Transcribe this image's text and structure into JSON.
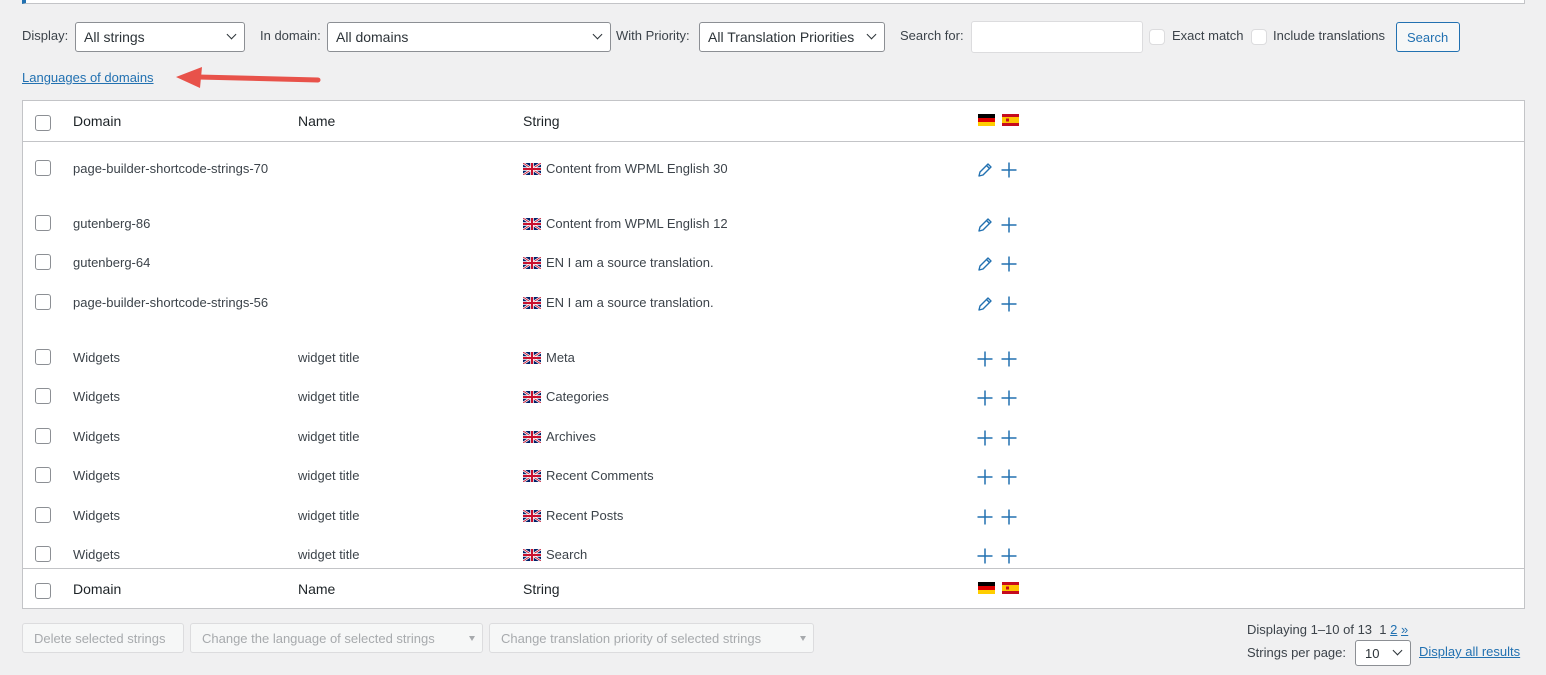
{
  "filters": {
    "display_label": "Display:",
    "display_value": "All strings",
    "domain_label": "In domain:",
    "domain_value": "All domains",
    "priority_label": "With Priority:",
    "priority_value": "All Translation Priorities",
    "search_label": "Search for:",
    "search_value": "",
    "exact_match_label": "Exact match",
    "include_translations_label": "Include translations",
    "search_button": "Search"
  },
  "languages_link": "Languages of domains",
  "columns": {
    "domain": "Domain",
    "name": "Name",
    "string": "String"
  },
  "language_flags": [
    "german-flag",
    "spanish-flag"
  ],
  "rows": [
    {
      "domain": "page-builder-shortcode-strings-70",
      "name": "",
      "string": "Content from WPML English 30",
      "actions": [
        "pencil-icon",
        "plus-icon"
      ]
    },
    {
      "domain": "gutenberg-86",
      "name": "",
      "string": "Content from WPML English 12",
      "actions": [
        "pencil-icon",
        "plus-icon"
      ]
    },
    {
      "domain": "gutenberg-64",
      "name": "",
      "string": "EN I am a source translation.",
      "actions": [
        "pencil-icon",
        "plus-icon"
      ]
    },
    {
      "domain": "page-builder-shortcode-strings-56",
      "name": "",
      "string": "EN I am a source translation.",
      "actions": [
        "pencil-icon",
        "plus-icon"
      ]
    },
    {
      "domain": "Widgets",
      "name": "widget title",
      "string": "Meta",
      "actions": [
        "plus-icon",
        "plus-icon"
      ]
    },
    {
      "domain": "Widgets",
      "name": "widget title",
      "string": "Categories",
      "actions": [
        "plus-icon",
        "plus-icon"
      ]
    },
    {
      "domain": "Widgets",
      "name": "widget title",
      "string": "Archives",
      "actions": [
        "plus-icon",
        "plus-icon"
      ]
    },
    {
      "domain": "Widgets",
      "name": "widget title",
      "string": "Recent Comments",
      "actions": [
        "plus-icon",
        "plus-icon"
      ]
    },
    {
      "domain": "Widgets",
      "name": "widget title",
      "string": "Recent Posts",
      "actions": [
        "plus-icon",
        "plus-icon"
      ]
    },
    {
      "domain": "Widgets",
      "name": "widget title",
      "string": "Search",
      "actions": [
        "plus-icon",
        "plus-icon"
      ]
    }
  ],
  "bulk": {
    "delete": "Delete selected strings",
    "change_language": "Change the language of selected strings",
    "change_priority": "Change translation priority of selected strings"
  },
  "pagination": {
    "displaying": "Displaying 1–10 of 13",
    "current_page": "1",
    "page_2": "2",
    "next": "»",
    "per_page_label": "Strings per page:",
    "per_page_value": "10",
    "display_all": "Display all results"
  },
  "colors": {
    "accent": "#2271b1",
    "arrow": "#e8524a"
  }
}
